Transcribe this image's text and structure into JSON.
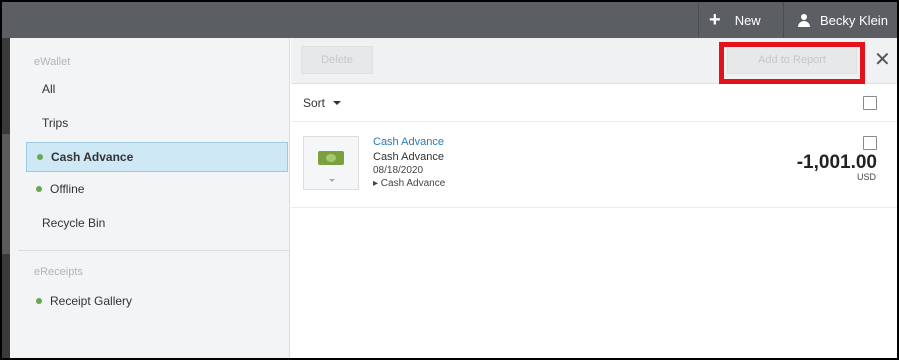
{
  "topbar": {
    "new_label": "New",
    "user_name": "Becky Klein"
  },
  "sidebar": {
    "ewallet_title": "eWallet",
    "items": [
      {
        "label": "All"
      },
      {
        "label": "Trips"
      },
      {
        "label": "Cash Advance"
      },
      {
        "label": "Offline"
      },
      {
        "label": "Recycle Bin"
      }
    ],
    "ereceipts_title": "eReceipts",
    "receipt_item": {
      "label": "Receipt Gallery"
    }
  },
  "toolbar": {
    "delete_label": "Delete",
    "add_report_label": "Add to Report",
    "close_symbol": "✕"
  },
  "sort": {
    "label": "Sort"
  },
  "transactions": [
    {
      "title": "Cash Advance",
      "type": "Cash Advance",
      "date": "08/18/2020",
      "detail": "▸ Cash Advance",
      "amount": "-1,001.00",
      "currency": "USD"
    }
  ],
  "colors": {
    "selected_bg": "#cfe8f5",
    "highlight": "#e3121b",
    "status_dot": "#6aa84f"
  }
}
